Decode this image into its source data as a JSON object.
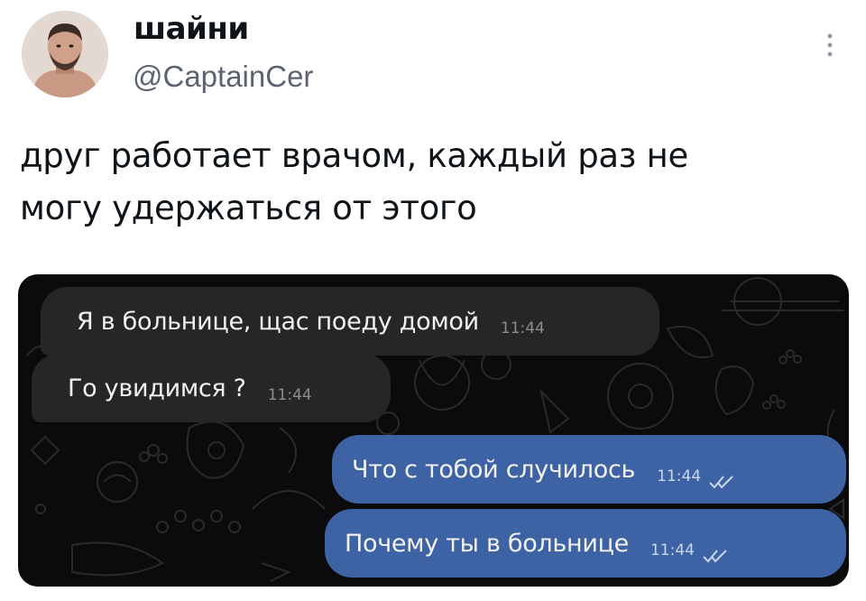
{
  "tweet": {
    "display_name": "шайни",
    "handle": "@CaptainCer",
    "text_line1": "друг работает врачом, каждый раз не",
    "text_line2": "могу удержаться от этого"
  },
  "chat": {
    "messages": [
      {
        "direction": "incoming",
        "text": "Я в больнице, щас поеду домой",
        "time": "11:44"
      },
      {
        "direction": "incoming",
        "text": "Го увидимся ?",
        "time": "11:44"
      },
      {
        "direction": "outgoing",
        "text": "Что с тобой случилось",
        "time": "11:44",
        "status": "read"
      },
      {
        "direction": "outgoing",
        "text": "Почему ты в больнице",
        "time": "11:44",
        "status": "read"
      }
    ]
  },
  "colors": {
    "background": "#ffffff",
    "chat_background": "#0b0b0d",
    "incoming_bubble": "#262628",
    "outgoing_bubble": "#3d63a4",
    "handle_text": "#5b6470"
  },
  "icons": {
    "more": "vertical-dots-icon",
    "read_status": "double-check-icon"
  }
}
